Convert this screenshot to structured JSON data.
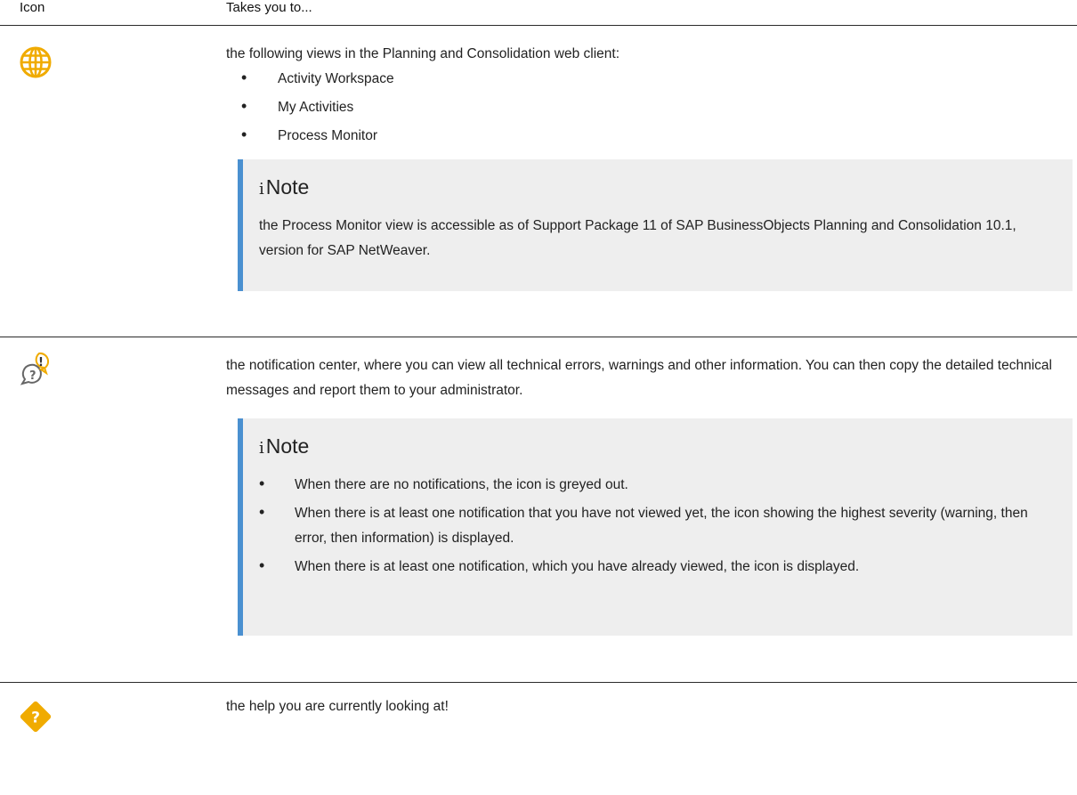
{
  "table": {
    "headers": {
      "icon": "Icon",
      "description": "Takes you to..."
    },
    "rows": [
      {
        "icon": "globe-icon",
        "text": "the following views in the Planning and Consolidation web client:",
        "bullets": [
          "Activity Workspace",
          "My Activities",
          "Process Monitor"
        ],
        "note": {
          "title": "Note",
          "text": "the Process Monitor view is accessible as of Support Package 11 of SAP BusinessObjects Planning and Consolidation 10.1, version for SAP NetWeaver."
        }
      },
      {
        "icon": "notification-icon",
        "text": "the notification center, where you can view all technical errors, warnings and other information. You can then copy the detailed technical messages and report them to your administrator.",
        "note": {
          "title": "Note",
          "bullets": [
            "When there are no notifications, the icon is greyed out.",
            "When there is at least one notification that you have not viewed yet, the icon showing the highest severity (warning, then error, then information) is displayed.",
            "When there is at least one notification, which you have already viewed, the icon is displayed."
          ]
        }
      },
      {
        "icon": "help-icon",
        "text": "the help you are currently looking at!"
      }
    ]
  },
  "colors": {
    "accent_bar": "#4a90d0",
    "note_bg": "#eeeeee",
    "icon_yellow": "#f0ab00",
    "icon_grey": "#666666"
  }
}
